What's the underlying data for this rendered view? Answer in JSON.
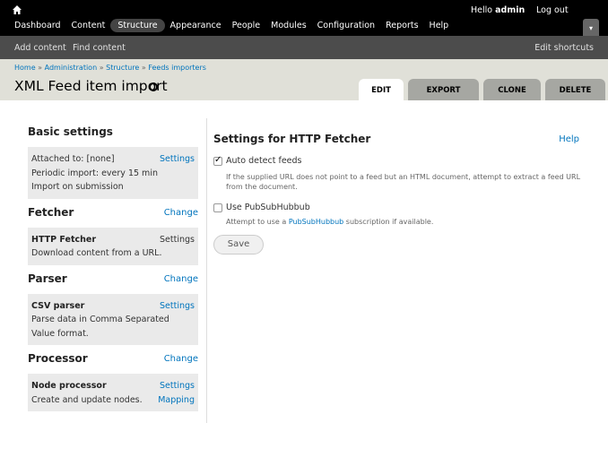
{
  "toolbar": {
    "greeting": "Hello ",
    "username": "admin",
    "logout": "Log out",
    "menu": [
      "Dashboard",
      "Content",
      "Structure",
      "Appearance",
      "People",
      "Modules",
      "Configuration",
      "Reports",
      "Help"
    ],
    "active_menu": "Structure"
  },
  "shortcuts": {
    "items": [
      "Add content",
      "Find content"
    ],
    "edit": "Edit shortcuts"
  },
  "breadcrumb": [
    "Home",
    "Administration",
    "Structure",
    "Feeds importers"
  ],
  "page_title": "XML Feed item import",
  "tabs": [
    "Edit",
    "Export",
    "Clone",
    "Delete"
  ],
  "active_tab": "Edit",
  "sidebar": {
    "basic": {
      "title": "Basic settings",
      "attached": "Attached to: [none]",
      "settings_link": "Settings",
      "periodic": "Periodic import: every 15 min",
      "import_on_submit": "Import on submission"
    },
    "fetcher": {
      "title": "Fetcher",
      "change": "Change",
      "name": "HTTP Fetcher",
      "settings": "Settings",
      "desc": "Download content from a URL."
    },
    "parser": {
      "title": "Parser",
      "change": "Change",
      "name": "CSV parser",
      "settings": "Settings",
      "desc": "Parse data in Comma Separated Value format."
    },
    "processor": {
      "title": "Processor",
      "change": "Change",
      "name": "Node processor",
      "settings": "Settings",
      "desc": "Create and update nodes.",
      "mapping": "Mapping"
    }
  },
  "main": {
    "title": "Settings for HTTP Fetcher",
    "help": "Help",
    "auto_detect": {
      "label": "Auto detect feeds",
      "checked": true,
      "desc": "If the supplied URL does not point to a feed but an HTML document, attempt to extract a feed URL from the document."
    },
    "pubsub": {
      "label": "Use PubSubHubbub",
      "checked": false,
      "desc_pre": "Attempt to use a ",
      "desc_link": "PubSubHubbub",
      "desc_post": " subscription if available."
    },
    "save": "Save"
  }
}
